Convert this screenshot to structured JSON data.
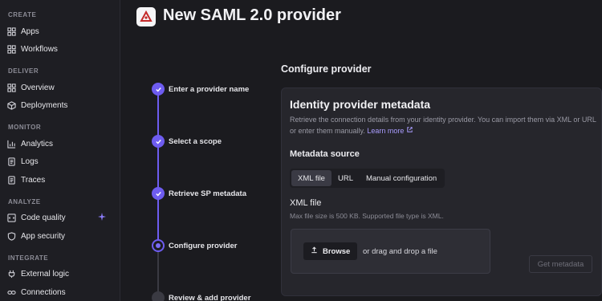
{
  "sidebar": {
    "sections": [
      {
        "title": "CREATE",
        "items": [
          {
            "label": "Apps",
            "icon": "grid-icon"
          },
          {
            "label": "Workflows",
            "icon": "grid-icon"
          }
        ]
      },
      {
        "title": "DELIVER",
        "items": [
          {
            "label": "Overview",
            "icon": "grid-icon"
          },
          {
            "label": "Deployments",
            "icon": "cube-icon"
          }
        ]
      },
      {
        "title": "MONITOR",
        "items": [
          {
            "label": "Analytics",
            "icon": "chart-icon"
          },
          {
            "label": "Logs",
            "icon": "document-icon"
          },
          {
            "label": "Traces",
            "icon": "document-icon"
          }
        ]
      },
      {
        "title": "ANALYZE",
        "items": [
          {
            "label": "Code quality",
            "icon": "code-icon",
            "badge": "sparkle-icon"
          },
          {
            "label": "App security",
            "icon": "shield-icon"
          }
        ]
      },
      {
        "title": "INTEGRATE",
        "items": [
          {
            "label": "External logic",
            "icon": "plug-icon"
          },
          {
            "label": "Connections",
            "icon": "link-icon"
          }
        ]
      }
    ]
  },
  "header": {
    "title": "New SAML 2.0 provider",
    "logo_icon": "provider-logo-icon"
  },
  "stepper": {
    "steps": [
      {
        "label": "Enter a provider name",
        "state": "done"
      },
      {
        "label": "Select a scope",
        "state": "done"
      },
      {
        "label": "Retrieve SP metadata",
        "state": "done"
      },
      {
        "label": "Configure provider",
        "state": "current"
      },
      {
        "label": "Review & add provider",
        "state": "pending"
      }
    ]
  },
  "main": {
    "section_title": "Configure provider",
    "panel": {
      "title": "Identity provider metadata",
      "description": "Retrieve the connection details from your identity provider. You can import them via XML or URL or enter them manually.",
      "learn_more": "Learn more",
      "metadata_source_label": "Metadata source",
      "source_options": [
        "XML file",
        "URL",
        "Manual configuration"
      ],
      "selected_source": "XML file",
      "xml_label": "XML file",
      "xml_hint": "Max file size is 500 KB. Supported file type is XML.",
      "browse_label": "Browse",
      "drop_text": "or drag and drop a file",
      "get_metadata_label": "Get metadata"
    }
  },
  "colors": {
    "accent": "#6e5cf0",
    "link": "#a99cff",
    "background": "#1b1b1f",
    "panel": "#26262c"
  }
}
